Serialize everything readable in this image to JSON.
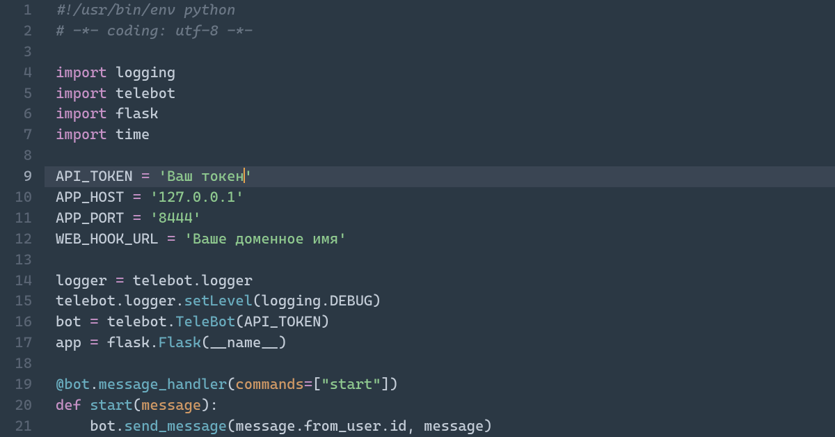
{
  "editor": {
    "current_line": 9,
    "cursor_line": 9,
    "lines": [
      {
        "n": 1,
        "tokens": [
          {
            "t": "#!/usr/bin/env python",
            "c": "comment"
          }
        ]
      },
      {
        "n": 2,
        "tokens": [
          {
            "t": "# -*- coding: utf-8 -*-",
            "c": "comment"
          }
        ]
      },
      {
        "n": 3,
        "tokens": []
      },
      {
        "n": 4,
        "tokens": [
          {
            "t": "import",
            "c": "kw"
          },
          {
            "t": " ",
            "c": "ident"
          },
          {
            "t": "logging",
            "c": "ident"
          }
        ]
      },
      {
        "n": 5,
        "tokens": [
          {
            "t": "import",
            "c": "kw"
          },
          {
            "t": " ",
            "c": "ident"
          },
          {
            "t": "telebot",
            "c": "ident"
          }
        ]
      },
      {
        "n": 6,
        "tokens": [
          {
            "t": "import",
            "c": "kw"
          },
          {
            "t": " ",
            "c": "ident"
          },
          {
            "t": "flask",
            "c": "ident"
          }
        ]
      },
      {
        "n": 7,
        "tokens": [
          {
            "t": "import",
            "c": "kw"
          },
          {
            "t": " ",
            "c": "ident"
          },
          {
            "t": "time",
            "c": "ident"
          }
        ]
      },
      {
        "n": 8,
        "tokens": []
      },
      {
        "n": 9,
        "tokens": [
          {
            "t": "API_TOKEN ",
            "c": "ident"
          },
          {
            "t": "=",
            "c": "op"
          },
          {
            "t": " ",
            "c": "ident"
          },
          {
            "t": "'Ваш токен",
            "c": "str"
          },
          {
            "t": "",
            "c": "cursor"
          },
          {
            "t": "'",
            "c": "str"
          }
        ]
      },
      {
        "n": 10,
        "tokens": [
          {
            "t": "APP_HOST ",
            "c": "ident"
          },
          {
            "t": "=",
            "c": "op"
          },
          {
            "t": " ",
            "c": "ident"
          },
          {
            "t": "'127.0.0.1'",
            "c": "str"
          }
        ]
      },
      {
        "n": 11,
        "tokens": [
          {
            "t": "APP_PORT ",
            "c": "ident"
          },
          {
            "t": "=",
            "c": "op"
          },
          {
            "t": " ",
            "c": "ident"
          },
          {
            "t": "'8444'",
            "c": "str"
          }
        ]
      },
      {
        "n": 12,
        "tokens": [
          {
            "t": "WEB_HOOK_URL ",
            "c": "ident"
          },
          {
            "t": "=",
            "c": "op"
          },
          {
            "t": " ",
            "c": "ident"
          },
          {
            "t": "'Ваше доменное имя'",
            "c": "str"
          }
        ]
      },
      {
        "n": 13,
        "tokens": []
      },
      {
        "n": 14,
        "tokens": [
          {
            "t": "logger ",
            "c": "ident"
          },
          {
            "t": "=",
            "c": "op"
          },
          {
            "t": " telebot",
            "c": "ident"
          },
          {
            "t": ".",
            "c": "punct"
          },
          {
            "t": "logger",
            "c": "ident"
          }
        ]
      },
      {
        "n": 15,
        "tokens": [
          {
            "t": "telebot",
            "c": "ident"
          },
          {
            "t": ".",
            "c": "punct"
          },
          {
            "t": "logger",
            "c": "ident"
          },
          {
            "t": ".",
            "c": "punct"
          },
          {
            "t": "setLevel",
            "c": "fn"
          },
          {
            "t": "(",
            "c": "punct"
          },
          {
            "t": "logging",
            "c": "ident"
          },
          {
            "t": ".",
            "c": "punct"
          },
          {
            "t": "DEBUG",
            "c": "ident"
          },
          {
            "t": ")",
            "c": "punct"
          }
        ]
      },
      {
        "n": 16,
        "tokens": [
          {
            "t": "bot ",
            "c": "ident"
          },
          {
            "t": "=",
            "c": "op"
          },
          {
            "t": " telebot",
            "c": "ident"
          },
          {
            "t": ".",
            "c": "punct"
          },
          {
            "t": "TeleBot",
            "c": "fn"
          },
          {
            "t": "(",
            "c": "punct"
          },
          {
            "t": "API_TOKEN",
            "c": "ident"
          },
          {
            "t": ")",
            "c": "punct"
          }
        ]
      },
      {
        "n": 17,
        "tokens": [
          {
            "t": "app ",
            "c": "ident"
          },
          {
            "t": "=",
            "c": "op"
          },
          {
            "t": " flask",
            "c": "ident"
          },
          {
            "t": ".",
            "c": "punct"
          },
          {
            "t": "Flask",
            "c": "fn"
          },
          {
            "t": "(",
            "c": "punct"
          },
          {
            "t": "__name__",
            "c": "ident"
          },
          {
            "t": ")",
            "c": "punct"
          }
        ]
      },
      {
        "n": 18,
        "tokens": []
      },
      {
        "n": 19,
        "tokens": [
          {
            "t": "@bot",
            "c": "decor"
          },
          {
            "t": ".",
            "c": "punct"
          },
          {
            "t": "message_handler",
            "c": "fn"
          },
          {
            "t": "(",
            "c": "punct"
          },
          {
            "t": "commands",
            "c": "const"
          },
          {
            "t": "=",
            "c": "op"
          },
          {
            "t": "[",
            "c": "punct"
          },
          {
            "t": "\"start\"",
            "c": "str"
          },
          {
            "t": "]",
            "c": "punct"
          },
          {
            "t": ")",
            "c": "punct"
          }
        ]
      },
      {
        "n": 20,
        "tokens": [
          {
            "t": "def",
            "c": "kw"
          },
          {
            "t": " ",
            "c": "ident"
          },
          {
            "t": "start",
            "c": "fn"
          },
          {
            "t": "(",
            "c": "punct"
          },
          {
            "t": "message",
            "c": "const"
          },
          {
            "t": ")",
            "c": "punct"
          },
          {
            "t": ":",
            "c": "punct"
          }
        ]
      },
      {
        "n": 21,
        "tokens": [
          {
            "t": "    bot",
            "c": "ident"
          },
          {
            "t": ".",
            "c": "punct"
          },
          {
            "t": "send_message",
            "c": "fn"
          },
          {
            "t": "(",
            "c": "punct"
          },
          {
            "t": "message",
            "c": "ident"
          },
          {
            "t": ".",
            "c": "punct"
          },
          {
            "t": "from_user",
            "c": "ident"
          },
          {
            "t": ".",
            "c": "punct"
          },
          {
            "t": "id",
            "c": "ident"
          },
          {
            "t": ",",
            "c": "punct"
          },
          {
            "t": " message",
            "c": "ident"
          },
          {
            "t": ")",
            "c": "punct"
          }
        ]
      }
    ]
  }
}
